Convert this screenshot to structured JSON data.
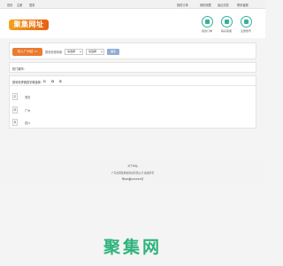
{
  "topbar": {
    "left": [
      "首页",
      "注册",
      "登录"
    ],
    "right": [
      "我的订单",
      "我的收藏",
      "最近浏览",
      "联系客服"
    ]
  },
  "header": {
    "logo_text": "聚集网址",
    "quick_links": [
      "我的订单",
      "联系客服",
      "注册账号"
    ]
  },
  "finder": {
    "join_button": "进入广州站 >>",
    "label": "按省份找商家:",
    "province_select": "请选择",
    "city_select": "请选择",
    "ok_button": "确定"
  },
  "hot_cities": {
    "label": "热门城市:"
  },
  "pinyin": {
    "label": "按省份拼音首字母选择:",
    "letters": [
      "C",
      "G",
      "S"
    ],
    "rows": [
      {
        "letter": "C",
        "city": "重庆"
      },
      {
        "letter": "G",
        "city": "广州"
      },
      {
        "letter": "S",
        "city": "四川"
      }
    ]
  },
  "footer": {
    "about": "关于本站",
    "copyright": "广东省聚集网络科技有限公司 版权所有",
    "icp": "粤ICP备XXXXXX号"
  },
  "brand": {
    "text": "聚集网"
  }
}
